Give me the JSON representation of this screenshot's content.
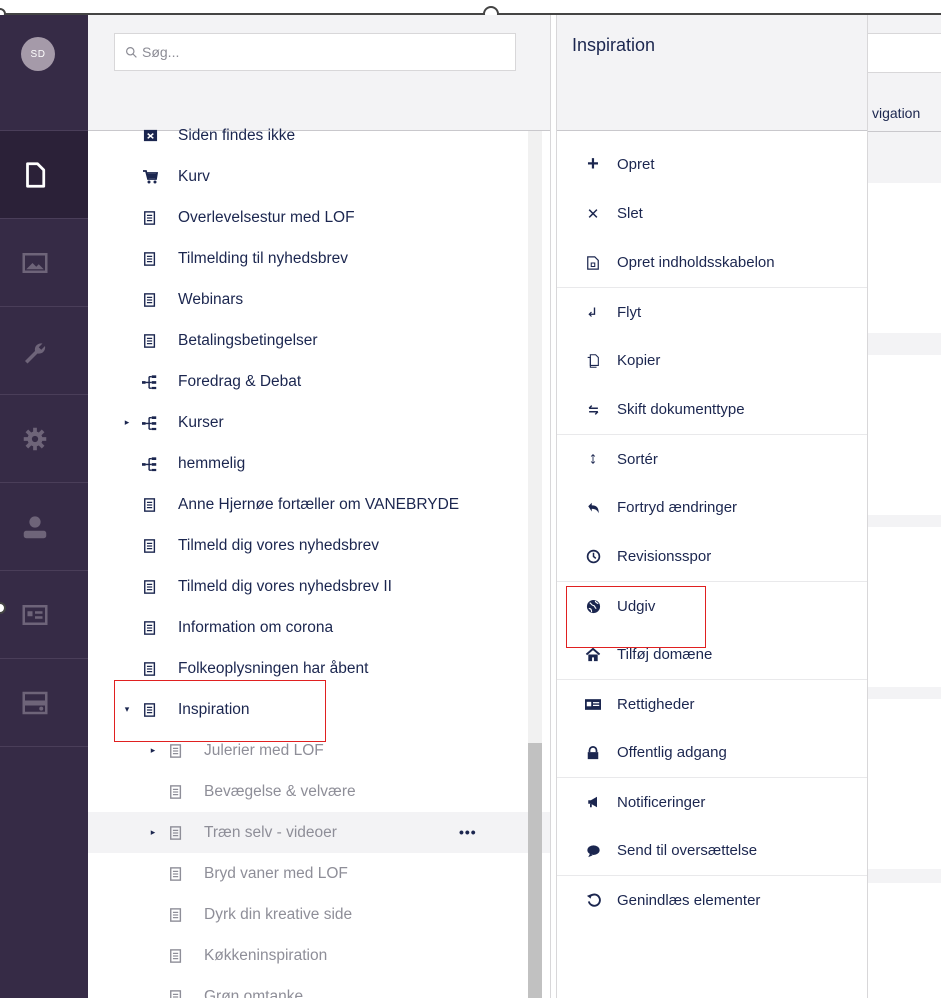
{
  "user": {
    "initials": "SD"
  },
  "search": {
    "placeholder": "Søg..."
  },
  "tree": {
    "items": [
      {
        "label": "Siden findes ikke",
        "icon": "error-page-icon",
        "child": false
      },
      {
        "label": "Kurv",
        "icon": "cart-icon",
        "child": false
      },
      {
        "label": "Overlevelsestur med LOF",
        "icon": "document-icon",
        "child": false
      },
      {
        "label": "Tilmelding til nyhedsbrev",
        "icon": "document-icon",
        "child": false
      },
      {
        "label": "Webinars",
        "icon": "document-icon",
        "child": false
      },
      {
        "label": "Betalingsbetingelser",
        "icon": "document-icon",
        "child": false
      },
      {
        "label": "Foredrag & Debat",
        "icon": "sitemap-icon",
        "child": false
      },
      {
        "label": "Kurser",
        "icon": "sitemap-icon",
        "child": false,
        "caret": "▸"
      },
      {
        "label": "hemmelig",
        "icon": "sitemap-icon",
        "child": false
      },
      {
        "label": "Anne Hjernøe fortæller om VANEBRYDE",
        "icon": "document-icon",
        "child": false
      },
      {
        "label": "Tilmeld dig vores nyhedsbrev",
        "icon": "document-icon",
        "child": false
      },
      {
        "label": "Tilmeld dig vores nyhedsbrev II",
        "icon": "document-icon",
        "child": false
      },
      {
        "label": "Information om corona",
        "icon": "document-icon",
        "child": false
      },
      {
        "label": "Folkeoplysningen har åbent",
        "icon": "document-icon",
        "child": false
      },
      {
        "label": "Inspiration",
        "icon": "document-icon",
        "child": false,
        "caret": "▾"
      },
      {
        "label": "Julerier med LOF",
        "icon": "document-icon",
        "child": true,
        "caret": "▸"
      },
      {
        "label": "Bevægelse & velvære",
        "icon": "document-icon",
        "child": true
      },
      {
        "label": "Træn selv - videoer",
        "icon": "document-icon",
        "child": true,
        "caret": "▸",
        "dots": "•••"
      },
      {
        "label": "Bryd vaner med LOF",
        "icon": "document-icon",
        "child": true
      },
      {
        "label": "Dyrk din kreative side",
        "icon": "document-icon",
        "child": true
      },
      {
        "label": "Køkkeninspiration",
        "icon": "document-icon",
        "child": true
      },
      {
        "label": "Grøn omtanke",
        "icon": "document-icon",
        "child": true
      }
    ]
  },
  "actions": {
    "title": "Inspiration",
    "items": [
      {
        "label": "Opret",
        "icon": "plus-icon"
      },
      {
        "label": "Slet",
        "icon": "close-icon"
      },
      {
        "label": "Opret indholdsskabelon",
        "icon": "template-icon"
      },
      {
        "label": "Flyt",
        "icon": "move-icon"
      },
      {
        "label": "Kopier",
        "icon": "copy-icon"
      },
      {
        "label": "Skift dokumenttype",
        "icon": "swap-icon"
      },
      {
        "label": "Sortér",
        "icon": "sort-icon"
      },
      {
        "label": "Fortryd ændringer",
        "icon": "undo-icon"
      },
      {
        "label": "Revisionsspor",
        "icon": "clock-icon"
      },
      {
        "label": "Udgiv",
        "icon": "globe-icon"
      },
      {
        "label": "Tilføj domæne",
        "icon": "home-icon"
      },
      {
        "label": "Rettigheder",
        "icon": "permissions-icon"
      },
      {
        "label": "Offentlig adgang",
        "icon": "lock-icon"
      },
      {
        "label": "Notificeringer",
        "icon": "megaphone-icon"
      },
      {
        "label": "Send til oversættelse",
        "icon": "chat-icon"
      },
      {
        "label": "Genindlæs elementer",
        "icon": "reload-icon"
      }
    ]
  },
  "right": {
    "tab_partial": "vigation"
  }
}
